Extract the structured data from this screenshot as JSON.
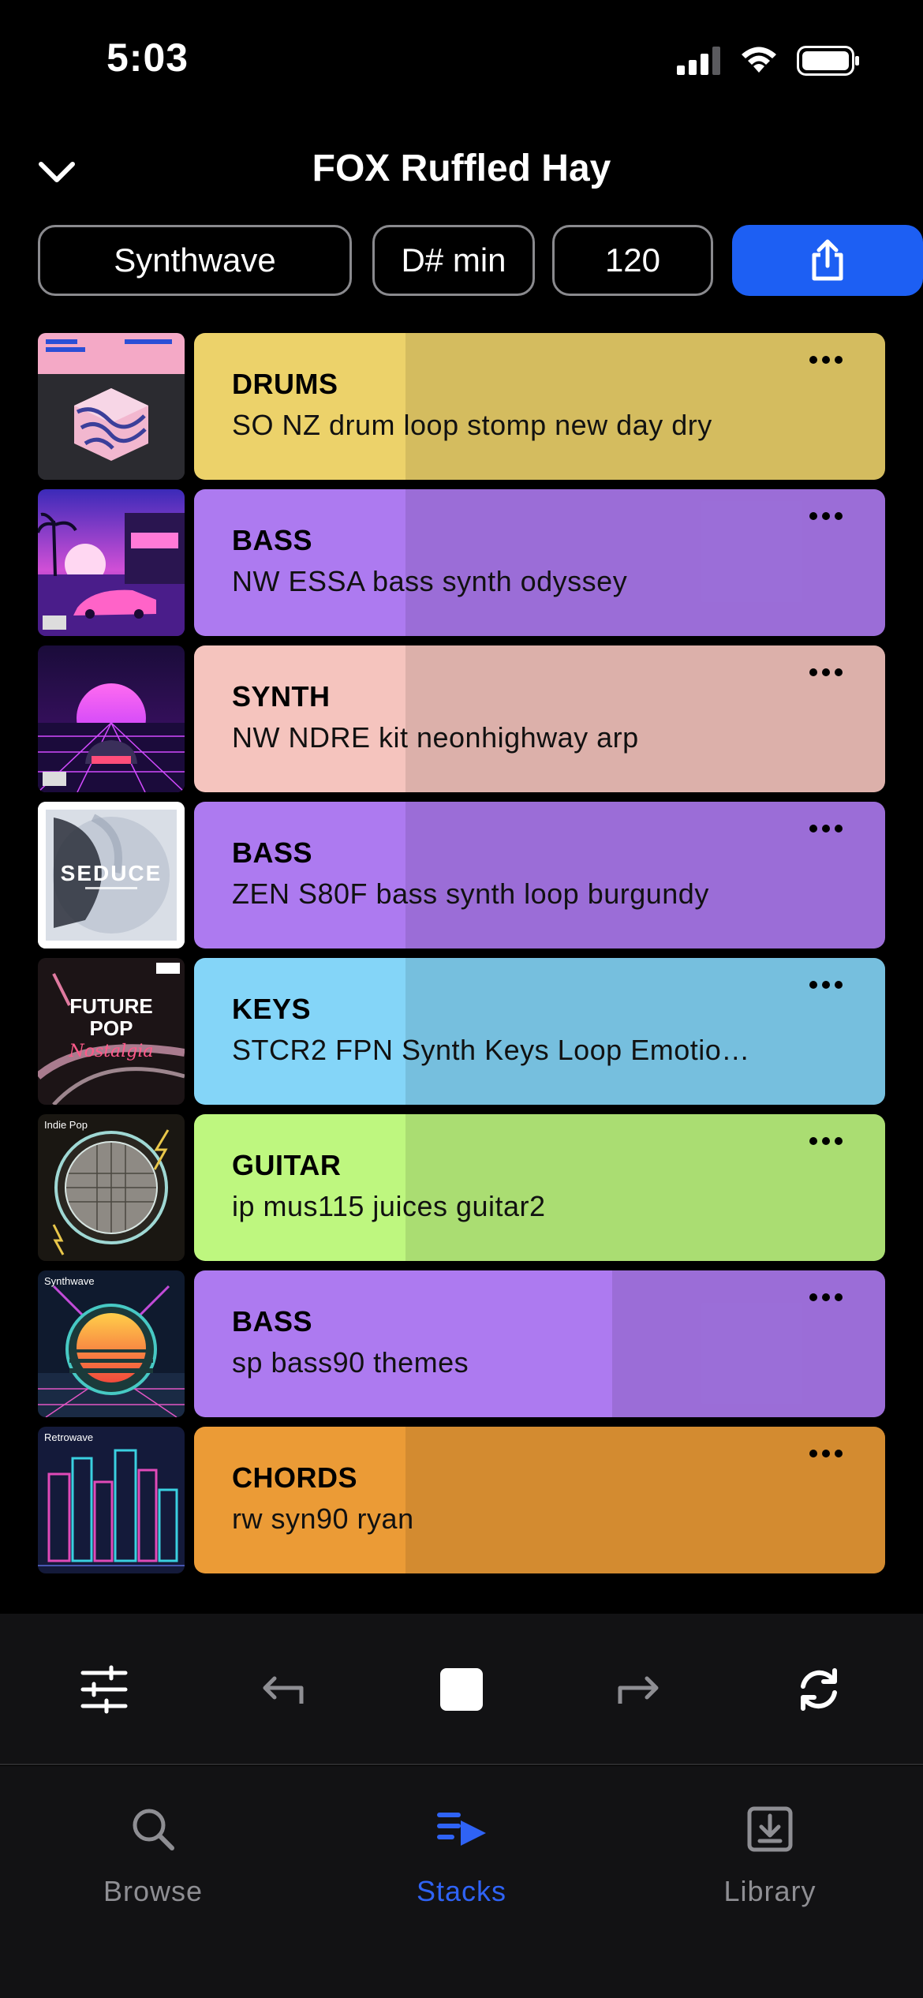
{
  "status_bar": {
    "time": "5:03",
    "icons": [
      "signal-icon",
      "wifi-icon",
      "battery-icon"
    ]
  },
  "header": {
    "title": "FOX Ruffled Hay",
    "collapse_icon": "chevron-down-icon"
  },
  "meta": {
    "genre": "Synthwave",
    "key": "D# min",
    "bpm": "120",
    "share_icon": "share-icon",
    "accent_color": "#1d5ff3"
  },
  "stacks": [
    {
      "type": "DRUMS",
      "name": "SO NZ drum loop stomp new day dry",
      "color": "#ecd26a",
      "progress": 0.3,
      "art": "cube"
    },
    {
      "type": "BASS",
      "name": "NW ESSA bass synth odyssey",
      "color": "#ad7af0",
      "progress": 0.3,
      "art": "sunset-car"
    },
    {
      "type": "SYNTH",
      "name": "NW NDRE kit neonhighway arp",
      "color": "#f5c4be",
      "progress": 0.3,
      "art": "neon-highway"
    },
    {
      "type": "BASS",
      "name": "ZEN S80F bass synth loop burgundy",
      "color": "#ad7af0",
      "progress": 0.3,
      "art": "seduce"
    },
    {
      "type": "KEYS",
      "name": "STCR2 FPN Synth Keys Loop Emotio…",
      "color": "#84d5f8",
      "progress": 0.3,
      "art": "future-pop"
    },
    {
      "type": "GUITAR",
      "name": "ip mus115 juices guitar2",
      "color": "#bef77f",
      "progress": 0.3,
      "art": "disco-ball"
    },
    {
      "type": "BASS",
      "name": "sp bass90 themes",
      "color": "#ad7af0",
      "progress": 0.6,
      "art": "synthwave-sun"
    },
    {
      "type": "CHORDS",
      "name": "rw syn90 ryan",
      "color": "#eb9b36",
      "progress": 0.3,
      "art": "retrowave-city"
    }
  ],
  "art_text": {
    "seduce_title": "SEDUCE",
    "future_pop_title": "FUTURE",
    "future_pop_title2": "POP",
    "future_pop_script": "Nostalgia",
    "disco_label": "Indie Pop",
    "synthwave_label": "Synthwave",
    "retrowave_label": "Retrowave"
  },
  "transport": {
    "icons": [
      "sliders-icon",
      "undo-icon",
      "stop-icon",
      "redo-icon",
      "refresh-icon"
    ]
  },
  "tabs": [
    {
      "label": "Browse",
      "icon": "search-icon",
      "active": false
    },
    {
      "label": "Stacks",
      "icon": "stacks-icon",
      "active": true
    },
    {
      "label": "Library",
      "icon": "download-box-icon",
      "active": false
    }
  ]
}
